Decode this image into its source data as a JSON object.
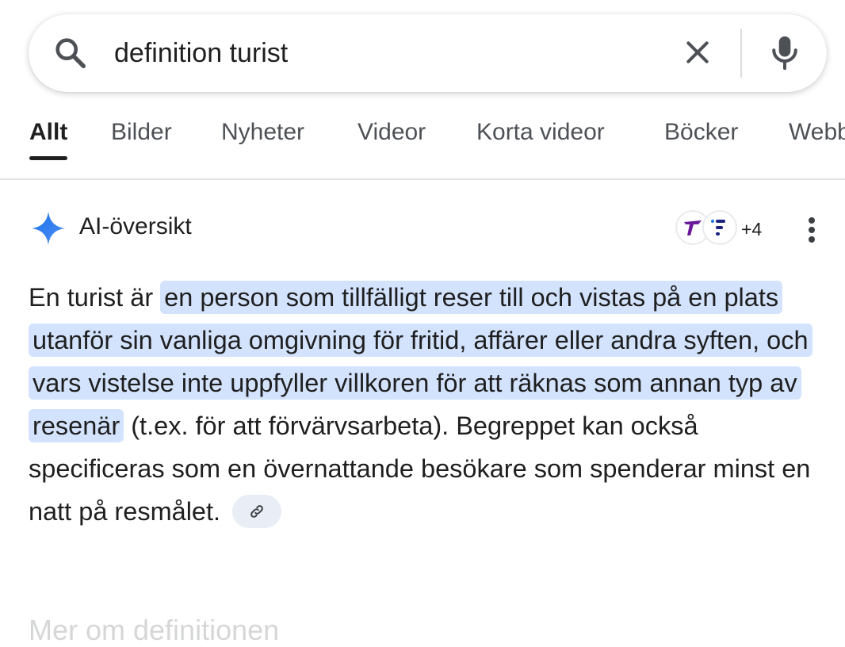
{
  "search": {
    "query": "definition turist"
  },
  "tabs": [
    {
      "label": "Allt"
    },
    {
      "label": "Bilder"
    },
    {
      "label": "Nyheter"
    },
    {
      "label": "Videor"
    },
    {
      "label": "Korta videor"
    },
    {
      "label": "Böcker"
    },
    {
      "label": "Webb"
    }
  ],
  "ai_overview": {
    "title": "AI-översikt",
    "sources_more": "+4",
    "answer": {
      "intro": "En turist är",
      "highlight": "en person som tillfälligt reser till och vistas på en plats utanför sin vanliga omgivning för fritid, affärer eller andra syften, och vars vistelse inte uppfyller villkoren för att räknas som annan typ av resenär",
      "rest": "(t.ex. för att förvärvsarbeta). Begreppet kan också specificeras som en övernattande besökare som spenderar minst en natt på resmålet."
    }
  },
  "next_section": {
    "heading": "Mer om definitionen"
  },
  "icons": {
    "search": "search-icon",
    "clear": "close-icon",
    "mic": "mic-icon",
    "ai": "sparkle-icon",
    "more": "more-vert-icon",
    "link": "link-icon"
  },
  "colors": {
    "highlight": "#d3e3fd",
    "ai_blue": "#4285f4"
  }
}
